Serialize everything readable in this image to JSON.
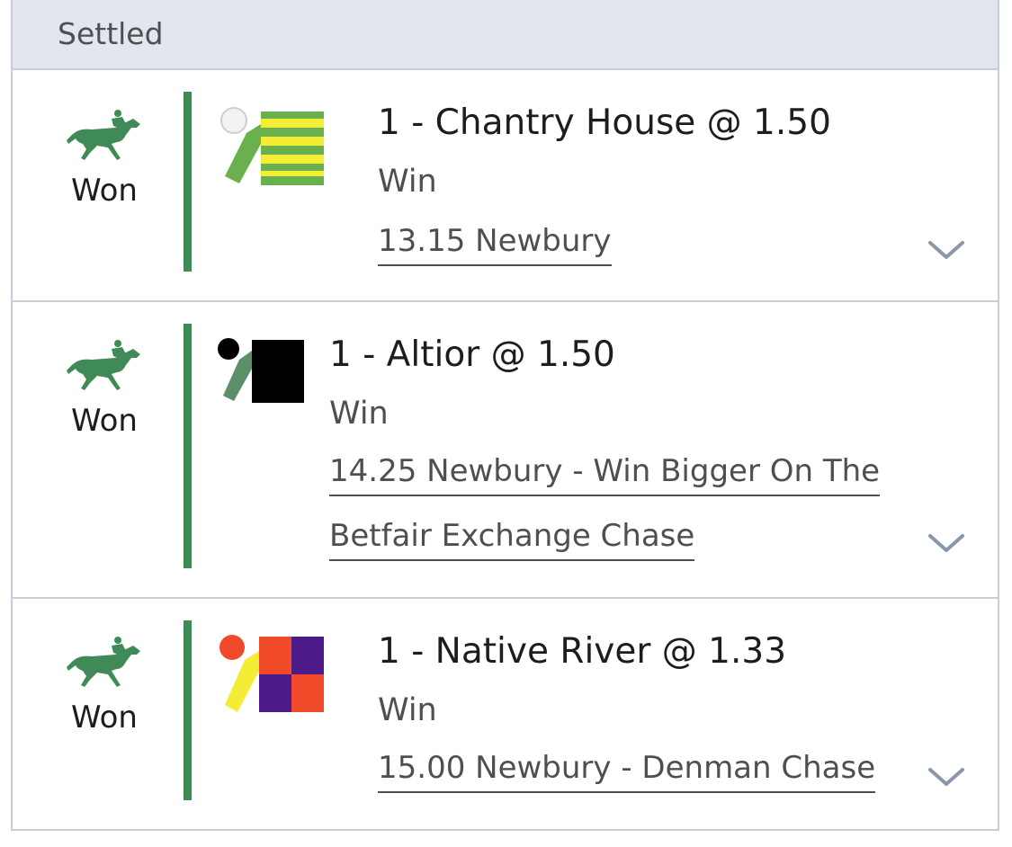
{
  "header": {
    "title": "Settled"
  },
  "colors": {
    "won_green": "#3f8a57",
    "header_bg": "#e3e6ee",
    "border": "#c6ccd8"
  },
  "bets": [
    {
      "status": "Won",
      "status_icon": "racehorse-icon",
      "silks_icon": "jockey-silks-green-yellow-icon",
      "selection": "1 - Chantry House @ 1.50",
      "market": "Win",
      "event_line1": "13.15 Newbury",
      "event_line2": ""
    },
    {
      "status": "Won",
      "status_icon": "racehorse-icon",
      "silks_icon": "jockey-silks-black-icon",
      "selection": "1 - Altior @ 1.50",
      "market": "Win",
      "event_line1": "14.25 Newbury - Win Bigger On The",
      "event_line2": "Betfair Exchange Chase"
    },
    {
      "status": "Won",
      "status_icon": "racehorse-icon",
      "silks_icon": "jockey-silks-purple-red-icon",
      "selection": "1 - Native River @ 1.33",
      "market": "Win",
      "event_line1": "15.00 Newbury - Denman Chase",
      "event_line2": ""
    }
  ]
}
